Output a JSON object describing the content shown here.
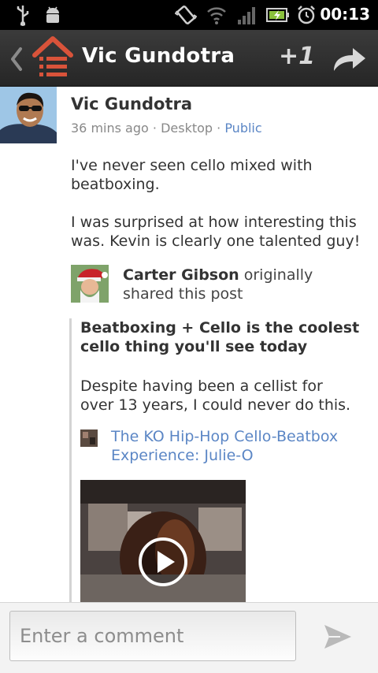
{
  "status_bar": {
    "time": "00:13",
    "icons": [
      "usb-icon",
      "android-debug-icon",
      "vibrate-icon",
      "wifi-icon",
      "signal-icon",
      "battery-charging-icon",
      "alarm-icon"
    ]
  },
  "action_bar": {
    "title": "Vic Gundotra",
    "plus_one_label": "+1",
    "icons": [
      "back-chevron-icon",
      "home-stream-icon",
      "share-arrow-icon"
    ]
  },
  "post": {
    "author": "Vic Gundotra",
    "time_ago": "36 mins ago",
    "separator": " · ",
    "source": "Desktop",
    "visibility": "Public",
    "paragraphs": [
      "I've never seen cello mixed with beatboxing.",
      "I was surprised at how interesting this was. Kevin is clearly one talented guy!"
    ],
    "reshare": {
      "original_author": "Carter Gibson",
      "shared_text": " originally shared this post",
      "title": "Beatboxing + Cello is the coolest cello thing you'll see today",
      "body": "Despite having been a cellist for over 13 years, I could never do this.",
      "link_text": "The KO Hip-Hop Cello-Beatbox Experience: Julie-O"
    }
  },
  "comment": {
    "placeholder": "Enter a comment"
  },
  "colors": {
    "link_blue": "#5b86c5",
    "bar_bg": "#2e2e2e",
    "home_red": "#d9533a"
  }
}
